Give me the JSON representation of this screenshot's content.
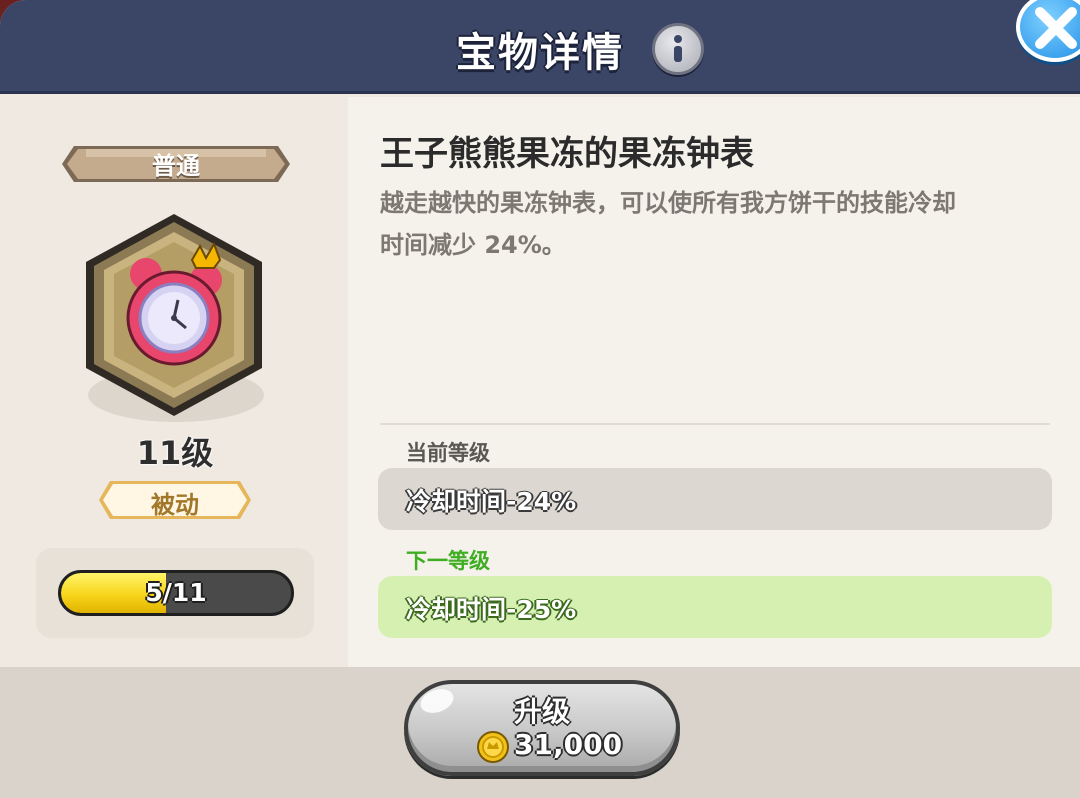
{
  "header": {
    "title": "宝物详情"
  },
  "treasure": {
    "rarity": "普通",
    "level": "11级",
    "type_badge": "被动",
    "progress_text": "5/11",
    "progress_fraction": 0.4545
  },
  "details": {
    "name": "王子熊熊果冻的果冻钟表",
    "description_line1": "越走越快的果冻钟表，可以使所有我方饼干的技能冷却",
    "description_line2": "时间减少 24%。",
    "current_label": "当前等级",
    "current_value": "冷却时间-24%",
    "next_label": "下一等级",
    "next_value": "冷却时间-25%"
  },
  "upgrade": {
    "label": "升级",
    "cost": "31,000"
  },
  "icons": [
    "info-icon",
    "close-icon",
    "coin-icon",
    "clock-treasure-icon"
  ],
  "colors": {
    "header": "#3b4566",
    "next_green": "#3fae23",
    "progress_yellow": "#f7d51a"
  }
}
